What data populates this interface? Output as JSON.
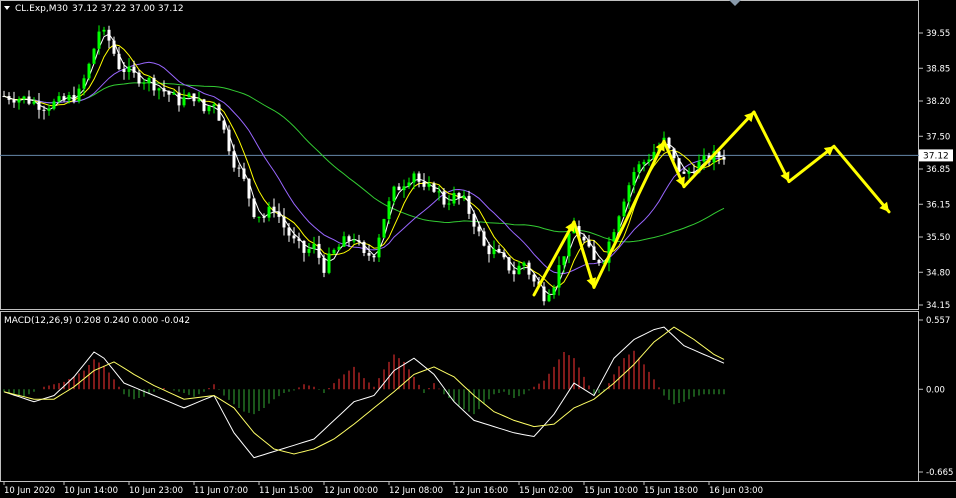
{
  "header": {
    "symbol_tf": "CL.Exp,M30",
    "ohlc": "37.12 37.22 37.00 37.12"
  },
  "indicator": {
    "label": "MACD(12,26,9) 0.208 0.240 0.000 -0.042"
  },
  "colors": {
    "background": "#000000",
    "frame": "#c0c0c0",
    "bull_candle": "#00ff00",
    "bear_candle": "#ffffff",
    "ma_fast": "#ffffff",
    "ma_mid": "#ffff00",
    "ma_slow": "#9966ff",
    "ma_long": "#33cc33",
    "macd_pos": "#ff3333",
    "macd_neg": "#33aa33",
    "forecast_arrow": "#ffff00",
    "price_line": "#6688aa"
  },
  "chart_data": [
    {
      "type": "candlestick",
      "panel": "price",
      "y_ticks": [
        "39.55",
        "38.85",
        "38.20",
        "37.50",
        "36.85",
        "36.15",
        "35.50",
        "34.80",
        "34.15"
      ],
      "ylim": [
        34.0,
        40.0
      ],
      "current_price": "37.12",
      "x_labels": [
        "10 Jun 2020",
        "10 Jun 14:00",
        "10 Jun 23:00",
        "11 Jun 07:00",
        "11 Jun 15:00",
        "12 Jun 00:00",
        "12 Jun 08:00",
        "12 Jun 16:00",
        "15 Jun 02:00",
        "15 Jun 10:00",
        "15 Jun 18:00",
        "16 Jun 03:00"
      ],
      "close_path": [
        [
          0,
          38.3
        ],
        [
          4,
          38.25
        ],
        [
          8,
          38.1
        ],
        [
          12,
          38.2
        ],
        [
          15,
          38.35
        ],
        [
          17,
          38.9
        ],
        [
          19,
          39.6
        ],
        [
          21,
          39.4
        ],
        [
          23,
          38.9
        ],
        [
          26,
          38.7
        ],
        [
          29,
          38.6
        ],
        [
          32,
          38.4
        ],
        [
          35,
          38.2
        ],
        [
          38,
          38.3
        ],
        [
          40,
          38.0
        ],
        [
          42,
          38.2
        ],
        [
          44,
          37.6
        ],
        [
          46,
          37.0
        ],
        [
          48,
          36.6
        ],
        [
          50,
          36.0
        ],
        [
          52,
          35.9
        ],
        [
          54,
          36.1
        ],
        [
          56,
          35.7
        ],
        [
          58,
          35.4
        ],
        [
          60,
          35.2
        ],
        [
          62,
          35.3
        ],
        [
          64,
          34.9
        ],
        [
          66,
          35.2
        ],
        [
          68,
          35.4
        ],
        [
          70,
          35.5
        ],
        [
          72,
          35.1
        ],
        [
          74,
          35.2
        ],
        [
          76,
          35.9
        ],
        [
          78,
          36.4
        ],
        [
          80,
          36.6
        ],
        [
          82,
          36.8
        ],
        [
          84,
          36.4
        ],
        [
          86,
          36.5
        ],
        [
          88,
          36.2
        ],
        [
          90,
          36.3
        ],
        [
          92,
          36.2
        ],
        [
          94,
          35.8
        ],
        [
          96,
          35.3
        ],
        [
          98,
          35.2
        ],
        [
          100,
          35.0
        ],
        [
          102,
          34.8
        ],
        [
          104,
          35.0
        ],
        [
          106,
          34.6
        ],
        [
          108,
          34.35
        ],
        [
          110,
          34.6
        ],
        [
          112,
          35.2
        ],
        [
          114,
          35.7
        ],
        [
          116,
          35.4
        ],
        [
          118,
          35.0
        ],
        [
          120,
          35.1
        ],
        [
          122,
          35.7
        ],
        [
          124,
          36.3
        ],
        [
          126,
          36.8
        ],
        [
          128,
          37.0
        ],
        [
          130,
          37.2
        ],
        [
          132,
          37.4
        ],
        [
          134,
          37.0
        ],
        [
          136,
          36.7
        ],
        [
          138,
          36.9
        ],
        [
          140,
          37.0
        ],
        [
          142,
          37.1
        ],
        [
          144,
          37.12
        ]
      ],
      "forecast": [
        [
          106,
          34.35
        ],
        [
          114,
          35.8
        ],
        [
          118,
          34.5
        ],
        [
          132,
          37.4
        ],
        [
          136,
          36.5
        ],
        [
          150,
          37.98
        ],
        [
          157,
          36.6
        ],
        [
          166,
          37.3
        ],
        [
          177,
          36.0
        ]
      ]
    },
    {
      "type": "bar",
      "panel": "macd",
      "y_ticks": [
        "0.557",
        "0.00",
        "-0.665"
      ],
      "ylim": [
        -0.665,
        0.557
      ],
      "histogram": [
        [
          0,
          -0.02
        ],
        [
          4,
          -0.06
        ],
        [
          8,
          0.02
        ],
        [
          12,
          0.06
        ],
        [
          16,
          0.15
        ],
        [
          18,
          0.24
        ],
        [
          20,
          0.19
        ],
        [
          22,
          0.08
        ],
        [
          24,
          -0.04
        ],
        [
          26,
          -0.08
        ],
        [
          28,
          -0.06
        ],
        [
          30,
          -0.02
        ],
        [
          32,
          0.01
        ],
        [
          34,
          -0.01
        ],
        [
          36,
          -0.03
        ],
        [
          38,
          -0.06
        ],
        [
          40,
          -0.02
        ],
        [
          42,
          0.04
        ],
        [
          44,
          -0.05
        ],
        [
          46,
          -0.12
        ],
        [
          48,
          -0.18
        ],
        [
          50,
          -0.2
        ],
        [
          52,
          -0.15
        ],
        [
          54,
          -0.08
        ],
        [
          56,
          -0.03
        ],
        [
          58,
          -0.01
        ],
        [
          60,
          0.04
        ],
        [
          62,
          0.02
        ],
        [
          64,
          -0.03
        ],
        [
          66,
          0.05
        ],
        [
          68,
          0.12
        ],
        [
          70,
          0.18
        ],
        [
          72,
          0.09
        ],
        [
          74,
          0.02
        ],
        [
          76,
          0.16
        ],
        [
          78,
          0.28
        ],
        [
          80,
          0.22
        ],
        [
          82,
          0.1
        ],
        [
          84,
          -0.03
        ],
        [
          86,
          0.05
        ],
        [
          88,
          -0.04
        ],
        [
          90,
          -0.1
        ],
        [
          92,
          -0.16
        ],
        [
          94,
          -0.2
        ],
        [
          96,
          -0.12
        ],
        [
          98,
          -0.04
        ],
        [
          100,
          -0.02
        ],
        [
          102,
          -0.07
        ],
        [
          104,
          -0.04
        ],
        [
          106,
          0.02
        ],
        [
          108,
          0.07
        ],
        [
          110,
          0.18
        ],
        [
          112,
          0.3
        ],
        [
          114,
          0.25
        ],
        [
          116,
          0.1
        ],
        [
          118,
          -0.04
        ],
        [
          120,
          -0.02
        ],
        [
          122,
          0.12
        ],
        [
          124,
          0.25
        ],
        [
          126,
          0.31
        ],
        [
          128,
          0.2
        ],
        [
          130,
          0.08
        ],
        [
          132,
          -0.05
        ],
        [
          134,
          -0.12
        ],
        [
          136,
          -0.1
        ],
        [
          138,
          -0.06
        ],
        [
          140,
          -0.04
        ],
        [
          142,
          -0.04
        ],
        [
          144,
          -0.04
        ]
      ],
      "macd_line": [
        [
          0,
          -0.02
        ],
        [
          6,
          -0.1
        ],
        [
          10,
          -0.05
        ],
        [
          14,
          0.1
        ],
        [
          18,
          0.3
        ],
        [
          20,
          0.25
        ],
        [
          24,
          0.05
        ],
        [
          30,
          -0.05
        ],
        [
          36,
          -0.15
        ],
        [
          42,
          -0.05
        ],
        [
          46,
          -0.35
        ],
        [
          50,
          -0.55
        ],
        [
          54,
          -0.5
        ],
        [
          58,
          -0.45
        ],
        [
          62,
          -0.4
        ],
        [
          66,
          -0.25
        ],
        [
          70,
          -0.1
        ],
        [
          74,
          -0.05
        ],
        [
          78,
          0.15
        ],
        [
          82,
          0.25
        ],
        [
          86,
          0.12
        ],
        [
          90,
          -0.1
        ],
        [
          94,
          -0.25
        ],
        [
          98,
          -0.3
        ],
        [
          102,
          -0.35
        ],
        [
          106,
          -0.38
        ],
        [
          110,
          -0.2
        ],
        [
          114,
          0.05
        ],
        [
          118,
          -0.05
        ],
        [
          122,
          0.25
        ],
        [
          126,
          0.4
        ],
        [
          130,
          0.48
        ],
        [
          132,
          0.5
        ],
        [
          136,
          0.35
        ],
        [
          140,
          0.28
        ],
        [
          144,
          0.21
        ]
      ],
      "signal_line": [
        [
          0,
          -0.02
        ],
        [
          6,
          -0.08
        ],
        [
          10,
          -0.08
        ],
        [
          14,
          0.02
        ],
        [
          18,
          0.15
        ],
        [
          22,
          0.22
        ],
        [
          26,
          0.12
        ],
        [
          30,
          0.03
        ],
        [
          36,
          -0.08
        ],
        [
          42,
          -0.05
        ],
        [
          46,
          -0.15
        ],
        [
          50,
          -0.35
        ],
        [
          54,
          -0.48
        ],
        [
          58,
          -0.52
        ],
        [
          62,
          -0.48
        ],
        [
          66,
          -0.4
        ],
        [
          70,
          -0.28
        ],
        [
          74,
          -0.15
        ],
        [
          78,
          -0.02
        ],
        [
          82,
          0.12
        ],
        [
          86,
          0.18
        ],
        [
          90,
          0.1
        ],
        [
          94,
          -0.05
        ],
        [
          98,
          -0.18
        ],
        [
          102,
          -0.25
        ],
        [
          106,
          -0.3
        ],
        [
          110,
          -0.28
        ],
        [
          114,
          -0.15
        ],
        [
          118,
          -0.08
        ],
        [
          122,
          0.05
        ],
        [
          126,
          0.2
        ],
        [
          130,
          0.38
        ],
        [
          134,
          0.5
        ],
        [
          138,
          0.4
        ],
        [
          142,
          0.28
        ],
        [
          144,
          0.24
        ]
      ]
    }
  ]
}
